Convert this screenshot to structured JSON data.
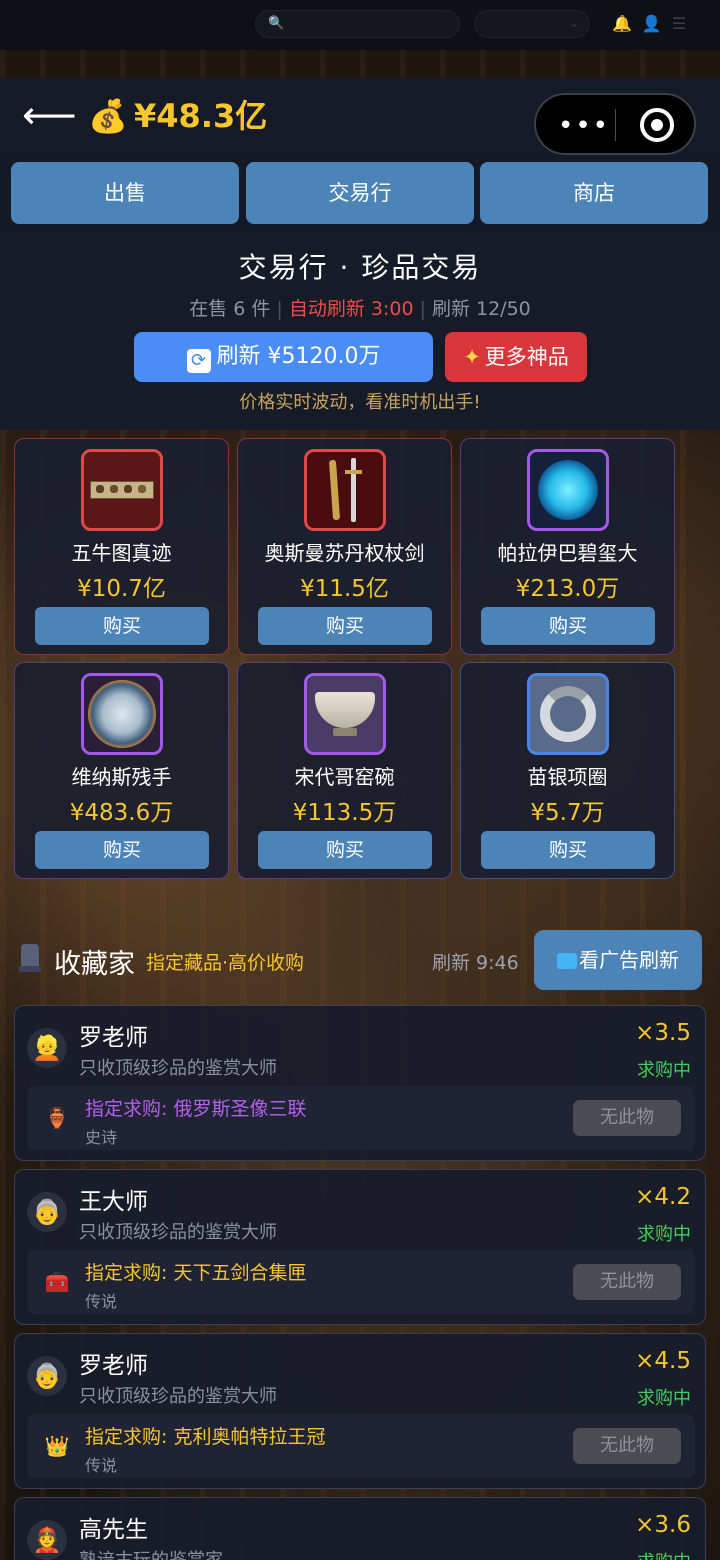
{
  "header": {
    "back_icon": "arrow-left-icon",
    "money_icon": "money-bag-icon",
    "money": "¥48.3亿"
  },
  "tabs": [
    {
      "label": "出售"
    },
    {
      "label": "交易行"
    },
    {
      "label": "商店"
    }
  ],
  "market": {
    "title": "交易行 · 珍品交易",
    "on_sale": "在售 6 件",
    "auto_refresh": "自动刷新 3:00",
    "refresh_count": "刷新 12/50",
    "refresh_button": "刷新 ¥5120.0万",
    "more_button": "更多神品",
    "hint": "价格实时波动，看准时机出手!"
  },
  "items": [
    {
      "name": "五牛图真迹",
      "price": "¥10.7亿",
      "buy": "购买",
      "rarity_color": "#e0484a"
    },
    {
      "name": "奥斯曼苏丹权杖剑",
      "price": "¥11.5亿",
      "buy": "购买",
      "rarity_color": "#e0484a"
    },
    {
      "name": "帕拉伊巴碧玺大",
      "price": "¥213.0万",
      "buy": "购买",
      "rarity_color": "#a25ae8"
    },
    {
      "name": "维纳斯残手",
      "price": "¥483.6万",
      "buy": "购买",
      "rarity_color": "#a25ae8"
    },
    {
      "name": "宋代哥窑碗",
      "price": "¥113.5万",
      "buy": "购买",
      "rarity_color": "#a25ae8"
    },
    {
      "name": "苗银项圈",
      "price": "¥5.7万",
      "buy": "购买",
      "rarity_color": "#4a86e8"
    }
  ],
  "collectors_section": {
    "title": "收藏家",
    "subtitle": "指定藏品·高价收购",
    "refresh_timer": "刷新 9:46",
    "ad_button": "看广告刷新"
  },
  "collectors": [
    {
      "name": "罗老师",
      "desc": "只收顶级珍品的鉴赏大师",
      "mult": "×3.5",
      "status": "求购中",
      "request": "指定求购: 俄罗斯圣像三联",
      "tier": "史诗",
      "tier_color": "#b061e8",
      "action": "无此物"
    },
    {
      "name": "王大师",
      "desc": "只收顶级珍品的鉴赏大师",
      "mult": "×4.2",
      "status": "求购中",
      "request": "指定求购: 天下五剑合集匣",
      "tier": "传说",
      "tier_color": "#f6c62d",
      "action": "无此物"
    },
    {
      "name": "罗老师",
      "desc": "只收顶级珍品的鉴赏大师",
      "mult": "×4.5",
      "status": "求购中",
      "request": "指定求购: 克利奥帕特拉王冠",
      "tier": "传说",
      "tier_color": "#f6c62d",
      "action": "无此物"
    },
    {
      "name": "高先生",
      "desc": "熟谙古玩的鉴赏家",
      "mult": "×3.6",
      "status": "求购中"
    }
  ]
}
